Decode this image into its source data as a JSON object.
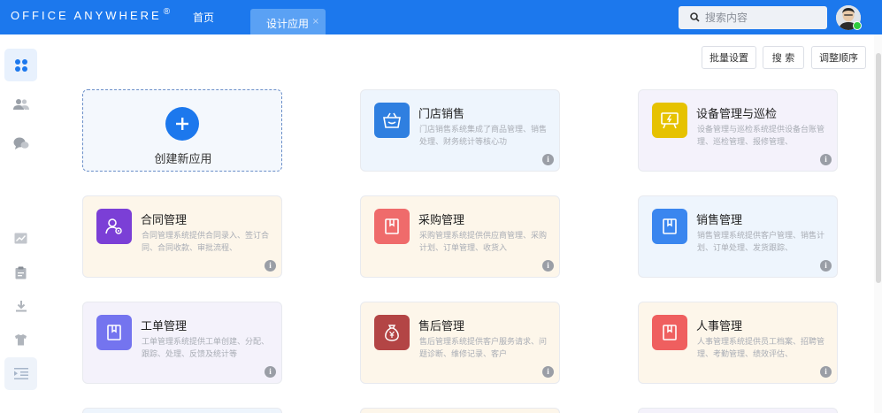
{
  "header": {
    "brand": "Office Anywhere",
    "brand_mark": "®",
    "nav_home": "首页",
    "active_tab": "设计应用",
    "tab_close": "×",
    "search_placeholder": "搜索内容",
    "accent_color": "#1c78ed"
  },
  "sidebar": {
    "items": [
      {
        "icon": "apps-grid-icon",
        "active": true
      },
      {
        "icon": "users-icon"
      },
      {
        "icon": "chat-bubbles-icon"
      },
      {
        "icon": "line-chart-icon"
      },
      {
        "icon": "clipboard-icon"
      },
      {
        "icon": "download-icon"
      },
      {
        "icon": "tshirt-icon"
      },
      {
        "icon": "indent-list-icon",
        "highlighted": true
      }
    ]
  },
  "actions": {
    "batch_settings": "批量设置",
    "search": "搜 索",
    "reorder": "调整顺序"
  },
  "new_app": {
    "label": "创建新应用"
  },
  "apps": [
    {
      "title": "门店销售",
      "desc": "门店销售系统集成了商品管理、销售处理、财务统计等核心功",
      "icon": "shopping-basket-icon",
      "icon_color": "#2f7fe0",
      "bg": "#eef5fd"
    },
    {
      "title": "设备管理与巡检",
      "desc": "设备管理与巡检系统提供设备台账管理、巡检管理、报修管理、",
      "icon": "presentation-board-icon",
      "icon_color": "#e6c200",
      "bg": "#f4f2fb"
    },
    {
      "title": "合同管理",
      "desc": "合同管理系统提供合同录入、签订合同、合同收款、审批流程、",
      "icon": "user-settings-icon",
      "icon_color": "#7b3fd6",
      "bg": "#fdf6ea"
    },
    {
      "title": "采购管理",
      "desc": "采购管理系统提供供应商管理、采购计划、订单管理、收货入",
      "icon": "bookmark-icon",
      "icon_color": "#ef6b6b",
      "bg": "#fdf6ea"
    },
    {
      "title": "销售管理",
      "desc": "销售管理系统提供客户管理、销售计划、订单处理、发货跟踪、",
      "icon": "bookmark-icon",
      "icon_color": "#3a86ef",
      "bg": "#eef5fd"
    },
    {
      "title": "工单管理",
      "desc": "工单管理系统提供工单创建、分配、跟踪、处理、反馈及统计等",
      "icon": "bookmark-icon",
      "icon_color": "#7474ef",
      "bg": "#f4f2fb"
    },
    {
      "title": "售后管理",
      "desc": "售后管理系统提供客户服务请求、问题诊断、维修记录、客户",
      "icon": "money-bag-icon",
      "icon_color": "#b34545",
      "bg": "#fdf6ea"
    },
    {
      "title": "人事管理",
      "desc": "人事管理系统提供员工档案、招聘管理、考勤管理、绩效评估、",
      "icon": "bookmark-icon",
      "icon_color": "#ef5f5f",
      "bg": "#fdf6ea"
    }
  ],
  "info_glyph": "i"
}
